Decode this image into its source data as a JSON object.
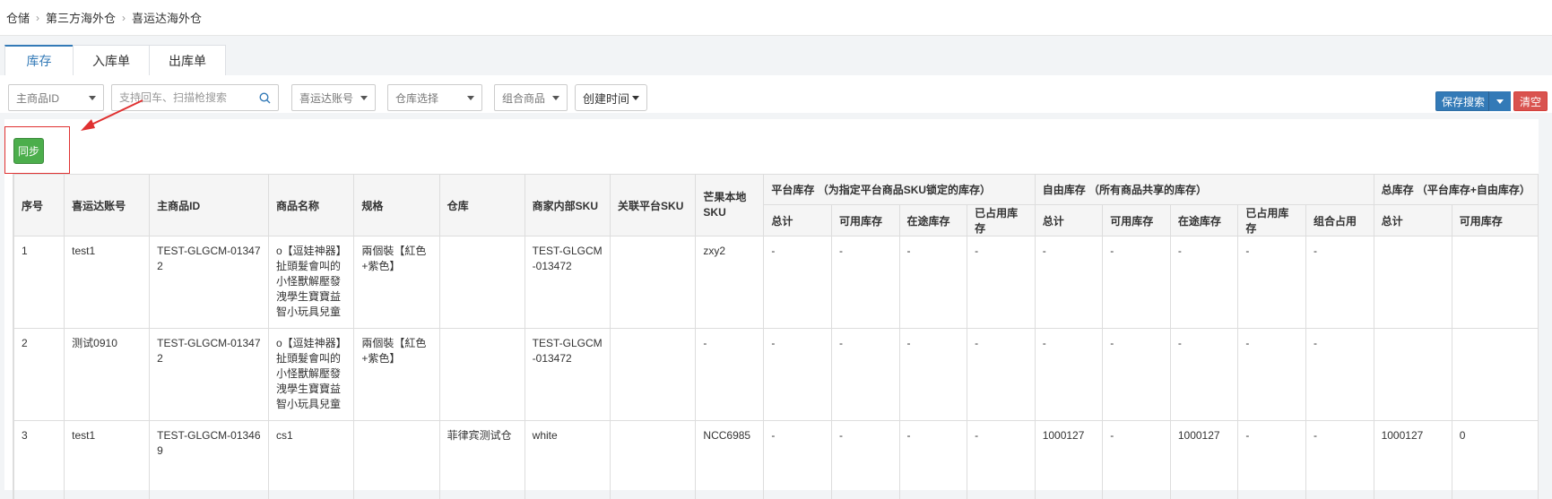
{
  "breadcrumb": [
    "仓储",
    "第三方海外仓",
    "喜运达海外仓"
  ],
  "tabs": [
    {
      "label": "库存",
      "active": true
    },
    {
      "label": "入库单",
      "active": false
    },
    {
      "label": "出库单",
      "active": false
    }
  ],
  "filters": {
    "main_product_id": "主商品ID",
    "search_placeholder": "支持回车、扫描枪搜索",
    "account": "喜运达账号",
    "warehouse": "仓库选择",
    "combo": "组合商品",
    "created_time": "创建时间"
  },
  "actions": {
    "save_search": "保存搜索",
    "clear": "清空",
    "sync": "同步"
  },
  "table": {
    "headers": {
      "seq": "序号",
      "account": "喜运达账号",
      "main_id": "主商品ID",
      "name": "商品名称",
      "spec": "规格",
      "warehouse": "仓库",
      "merchant_sku": "商家内部SKU",
      "platform_sku": "关联平台SKU",
      "local_sku": "芒果本地SKU",
      "platform_group": "平台库存 （为指定平台商品SKU锁定的库存）",
      "free_group": "自由库存 （所有商品共享的库存）",
      "total_group": "总库存 （平台库存+自由库存）"
    },
    "sub_headers": {
      "p_total": "总计",
      "p_available": "可用库存",
      "p_transit": "在途库存",
      "p_used": "已占用库存",
      "f_total": "总计",
      "f_available": "可用库存",
      "f_transit": "在途库存",
      "f_used": "已占用库存",
      "f_combo": "组合占用",
      "t_total": "总计",
      "t_available": "可用库存"
    },
    "rows": [
      {
        "seq": "1",
        "account": "test1",
        "main_id": "TEST-GLGCM-013472",
        "name": "o【逗娃神器】扯頭髮會叫的小怪獸解壓發洩學生寶寶益智小玩具兒童",
        "spec": "兩個裝【紅色+紫色】",
        "warehouse": "",
        "merchant_sku": "TEST-GLGCM-013472",
        "platform_sku": "",
        "local_sku": "zxy2",
        "p_total": "-",
        "p_available": "-",
        "p_transit": "-",
        "p_used": "-",
        "f_total": "-",
        "f_available": "-",
        "f_transit": "-",
        "f_used": "-",
        "f_combo": "-",
        "t_total": "",
        "t_available": ""
      },
      {
        "seq": "2",
        "account": "测试0910",
        "main_id": "TEST-GLGCM-013472",
        "name": "o【逗娃神器】扯頭髮會叫的小怪獸解壓發洩學生寶寶益智小玩具兒童",
        "spec": "兩個裝【紅色+紫色】",
        "warehouse": "",
        "merchant_sku": "TEST-GLGCM-013472",
        "platform_sku": "",
        "local_sku": "-",
        "p_total": "-",
        "p_available": "-",
        "p_transit": "-",
        "p_used": "-",
        "f_total": "-",
        "f_available": "-",
        "f_transit": "-",
        "f_used": "-",
        "f_combo": "-",
        "t_total": "",
        "t_available": ""
      },
      {
        "seq": "3",
        "account": "test1",
        "main_id": "TEST-GLGCM-013469",
        "name": "cs1",
        "spec": "",
        "warehouse": "菲律宾测试仓",
        "merchant_sku": "white",
        "platform_sku": "",
        "local_sku": "NCC6985",
        "p_total": "-",
        "p_available": "-",
        "p_transit": "-",
        "p_used": "-",
        "f_total": "1000127",
        "f_available": "-",
        "f_transit": "1000127",
        "f_used": "-",
        "f_combo": "-",
        "t_total": "1000127",
        "t_available": "0"
      }
    ]
  },
  "colors": {
    "primary": "#337ab7",
    "success": "#4cae4c",
    "danger": "#d9534f",
    "annotation": "#e03131"
  }
}
